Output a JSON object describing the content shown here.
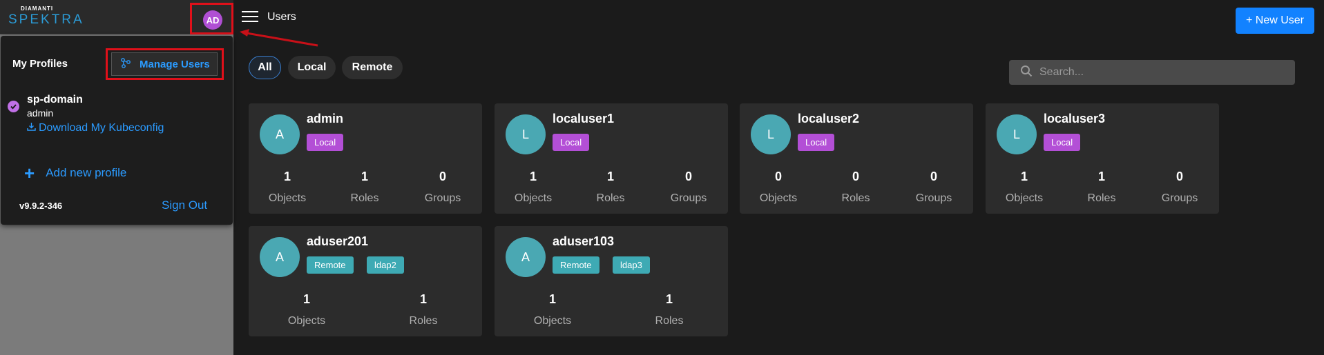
{
  "brand": {
    "small": "DIAMANTI",
    "name": "SPEKTRA"
  },
  "account": {
    "initials": "AD"
  },
  "profile_menu": {
    "title": "My Profiles",
    "manage_users": "Manage Users",
    "profile": {
      "domain": "sp-domain",
      "user": "admin",
      "kubeconfig_link": "Download My Kubeconfig"
    },
    "add_profile": "Add new profile",
    "version": "v9.9.2-346",
    "sign_out": "Sign Out"
  },
  "header": {
    "title": "Users",
    "new_user_button": "+ New User"
  },
  "filters": [
    "All",
    "Local",
    "Remote"
  ],
  "search": {
    "placeholder": "Search..."
  },
  "stat_labels": {
    "objects": "Objects",
    "roles": "Roles",
    "groups": "Groups"
  },
  "users": [
    {
      "initial": "A",
      "name": "admin",
      "tags": [
        "Local"
      ],
      "objects": "1",
      "roles": "1",
      "groups": "0"
    },
    {
      "initial": "L",
      "name": "localuser1",
      "tags": [
        "Local"
      ],
      "objects": "1",
      "roles": "1",
      "groups": "0"
    },
    {
      "initial": "L",
      "name": "localuser2",
      "tags": [
        "Local"
      ],
      "objects": "0",
      "roles": "0",
      "groups": "0"
    },
    {
      "initial": "L",
      "name": "localuser3",
      "tags": [
        "Local"
      ],
      "objects": "1",
      "roles": "1",
      "groups": "0"
    },
    {
      "initial": "A",
      "name": "aduser201",
      "tags": [
        "Remote",
        "ldap2"
      ],
      "objects": "1",
      "roles": "1"
    },
    {
      "initial": "A",
      "name": "aduser103",
      "tags": [
        "Remote",
        "ldap3"
      ],
      "objects": "1",
      "roles": "1"
    }
  ],
  "colors": {
    "accent": "#1282ff",
    "link": "#2b9bff",
    "local_tag": "#b34fd6",
    "remote_tag": "#3eaab4",
    "avatar": "#4aa8b3",
    "highlight": "#e0101a"
  }
}
